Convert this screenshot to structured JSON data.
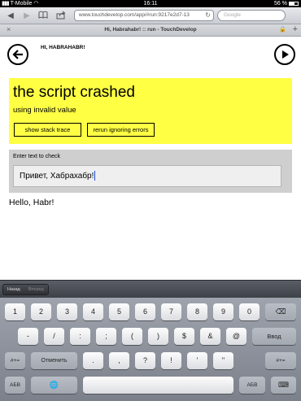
{
  "status_bar": {
    "carrier": "T-Mobile",
    "time": "16:11",
    "battery": "56 %"
  },
  "browser": {
    "url": "www.touchdevelop.com/app/#run:9217e2d7-13",
    "search_placeholder": "Google",
    "tab_title": "Hi, Habrahabr! :: run - TouchDevelop"
  },
  "page": {
    "greeting": "HI, HABRAHABR!",
    "error": {
      "title": "the script crashed",
      "subtitle": "using invalid value",
      "stack_trace_label": "show stack trace",
      "rerun_label": "rerun ignoring errors"
    },
    "input": {
      "label": "Enter text to check",
      "value": "Привет, Хабрахабр!"
    },
    "output": "Hello, Habr!"
  },
  "keyboard": {
    "accessory": {
      "back": "Назад",
      "forward": "Вперед"
    },
    "rows": [
      [
        "1",
        "2",
        "3",
        "4",
        "5",
        "6",
        "7",
        "8",
        "9",
        "0",
        "⌫"
      ],
      [
        "-",
        "/",
        ":",
        ";",
        "(",
        ")",
        "$",
        "&",
        "@",
        "Ввод"
      ],
      [
        "#+=",
        "Отменить",
        ".",
        ",",
        "?",
        "!",
        "'",
        "\"",
        "#+="
      ],
      [
        "АБВ",
        "🌐",
        "",
        "АБВ",
        "⌨"
      ]
    ]
  }
}
